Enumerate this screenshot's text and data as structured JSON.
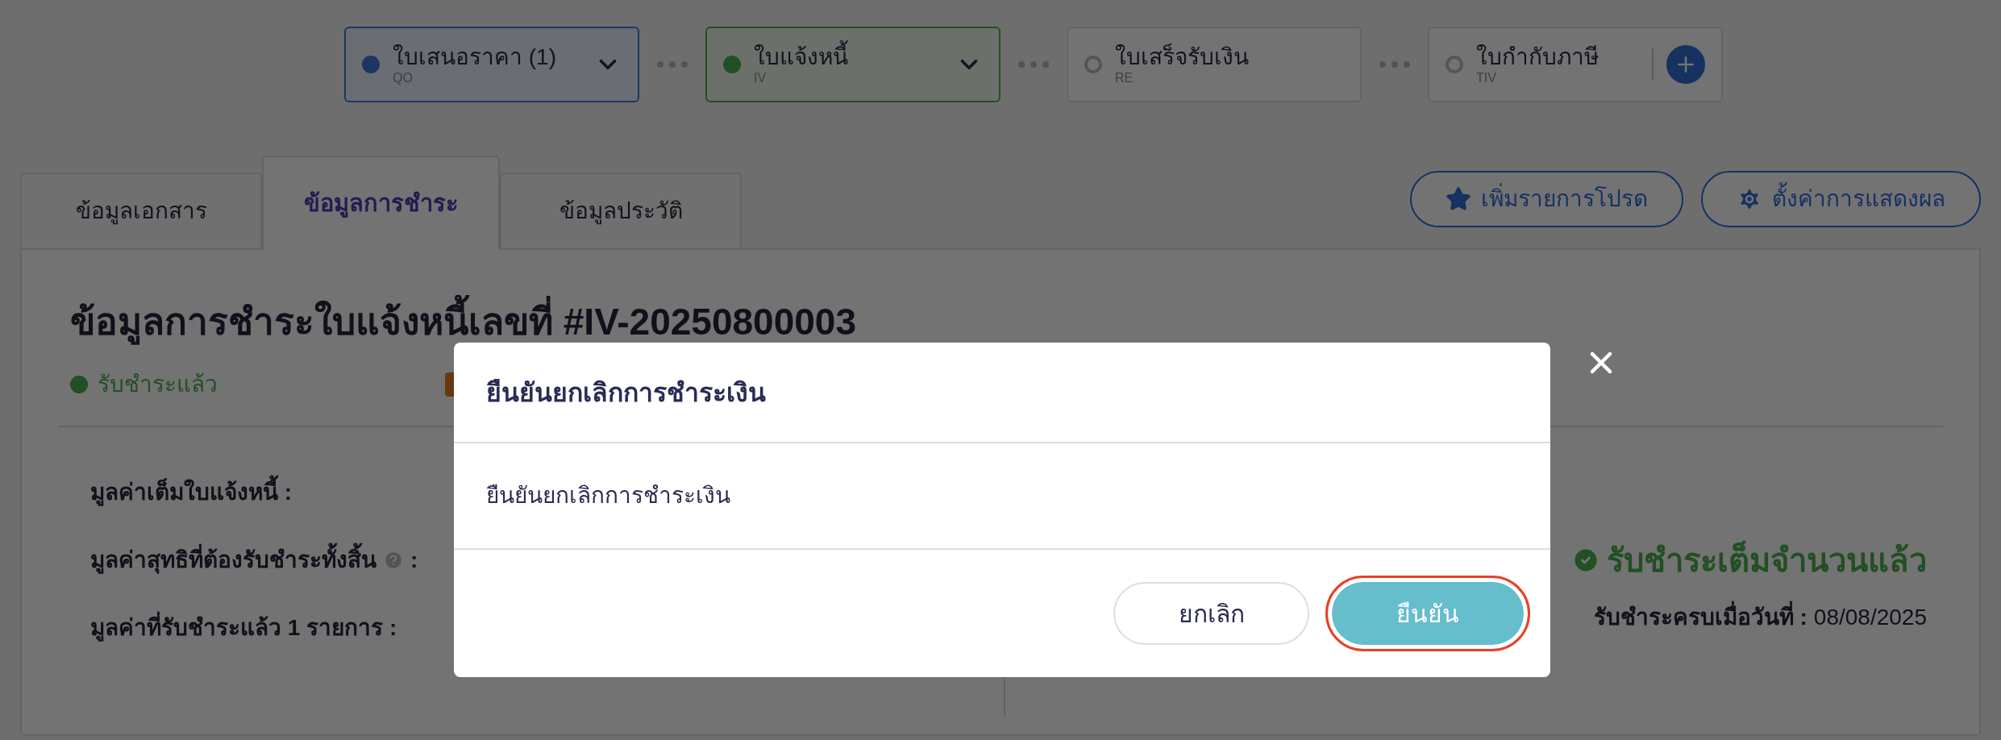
{
  "steps": [
    {
      "label": "ใบเสนอราคา (1)",
      "code": "QO",
      "kind": "done",
      "has_menu": true,
      "add_button": false
    },
    {
      "label": "ใบแจ้งหนี้",
      "code": "IV",
      "kind": "current",
      "has_menu": true,
      "add_button": false
    },
    {
      "label": "ใบเสร็จรับเงิน",
      "code": "RE",
      "kind": "pending",
      "has_menu": false,
      "add_button": false
    },
    {
      "label": "ใบกำกับภาษี",
      "code": "TIV",
      "kind": "pending",
      "has_menu": false,
      "add_button": true
    }
  ],
  "tabs": [
    {
      "label": "ข้อมูลเอกสาร",
      "selected": false
    },
    {
      "label": "ข้อมูลการชำระ",
      "selected": true
    },
    {
      "label": "ข้อมูลประวัติ",
      "selected": false
    }
  ],
  "actions": [
    {
      "label": "เพิ่มรายการโปรด",
      "kind": "star"
    },
    {
      "label": "ตั้งค่าการแสดงผล",
      "kind": "gear"
    }
  ],
  "payment": {
    "title": "ข้อมูลการชำระใบแจ้งหนี้เลขที่ #IV-20250800003",
    "status": "รับชำระแล้ว",
    "rows": [
      {
        "label": "มูลค่าเต็มใบแจ้งหนี้ :",
        "help": false
      },
      {
        "label": "มูลค่าสุทธิที่ต้องรับชำระทั้งสิ้น",
        "help": true,
        "suffix": ":"
      },
      {
        "label": "มูลค่าที่รับชำระแล้ว 1 รายการ :",
        "help": false
      }
    ],
    "paid_status": "รับชำระเต็มจำนวนแล้ว",
    "paid_date_label": "รับชำระครบเมื่อวันที่ :",
    "paid_date": "08/08/2025"
  },
  "modal": {
    "title": "ยืนยันยกเลิกการชำระเงิน",
    "message": "ยืนยันยกเลิกการชำระเงิน",
    "buttons": [
      {
        "label": "ยกเลิก",
        "kind": "secondary",
        "highlighted": false
      },
      {
        "label": "ยืนยัน",
        "kind": "primary",
        "highlighted": true
      }
    ]
  }
}
